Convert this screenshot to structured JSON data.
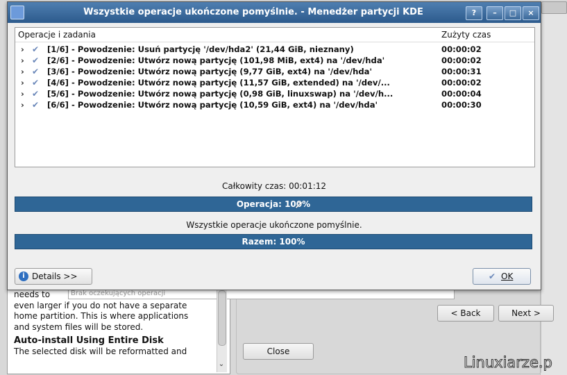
{
  "background": {
    "pending_placeholder": "Brak oczekujących operacji",
    "help_lines": [
      "needs to",
      "even larger if you do not have a separate",
      "home partition. This is where applications",
      "and system files will be stored."
    ],
    "help_heading": "Auto-install Using Entire Disk",
    "help_tail": "The selected disk will be reformatted and",
    "back_label": "< Back",
    "next_label": "Next >",
    "close_label": "Close",
    "watermark": "Linuxiarze.p"
  },
  "dialog": {
    "title": "Wszystkie operacje ukończone pomyślnie. - Menedżer partycji KDE",
    "titlebar_buttons": [
      "?",
      "–",
      "□",
      "×"
    ],
    "columns": {
      "operations": "Operacje i zadania",
      "time": "Zużyty czas"
    },
    "operations": [
      {
        "text": "[1/6] - Powodzenie: Usuń partycję '/dev/hda2' (21,44 GiB, nieznany)",
        "time": "00:00:02"
      },
      {
        "text": "[2/6] - Powodzenie: Utwórz nową partycję (101,98 MiB, ext4) na '/dev/hda'",
        "time": "00:00:02"
      },
      {
        "text": "[3/6] - Powodzenie: Utwórz nową partycję (9,77 GiB, ext4) na '/dev/hda'",
        "time": "00:00:31"
      },
      {
        "text": "[4/6] - Powodzenie: Utwórz nową partycję (11,57 GiB, extended) na '/dev/...",
        "time": "00:00:02"
      },
      {
        "text": "[5/6] - Powodzenie: Utwórz nową partycję (0,98 GiB, linuxswap) na '/dev/h...",
        "time": "00:00:04"
      },
      {
        "text": "[6/6] - Powodzenie: Utwórz nową partycję (10,59 GiB, ext4) na '/dev/hda'",
        "time": "00:00:30"
      }
    ],
    "total_time": "Całkowity czas: 00:01:12",
    "operation_progress": "Operacja: 100%",
    "operation_progress_value": 100,
    "status": "Wszystkie operacje ukończone pomyślnie.",
    "total_progress": "Razem: 100%",
    "total_progress_value": 100,
    "details_label": "Details >>",
    "ok_label": "OK"
  }
}
